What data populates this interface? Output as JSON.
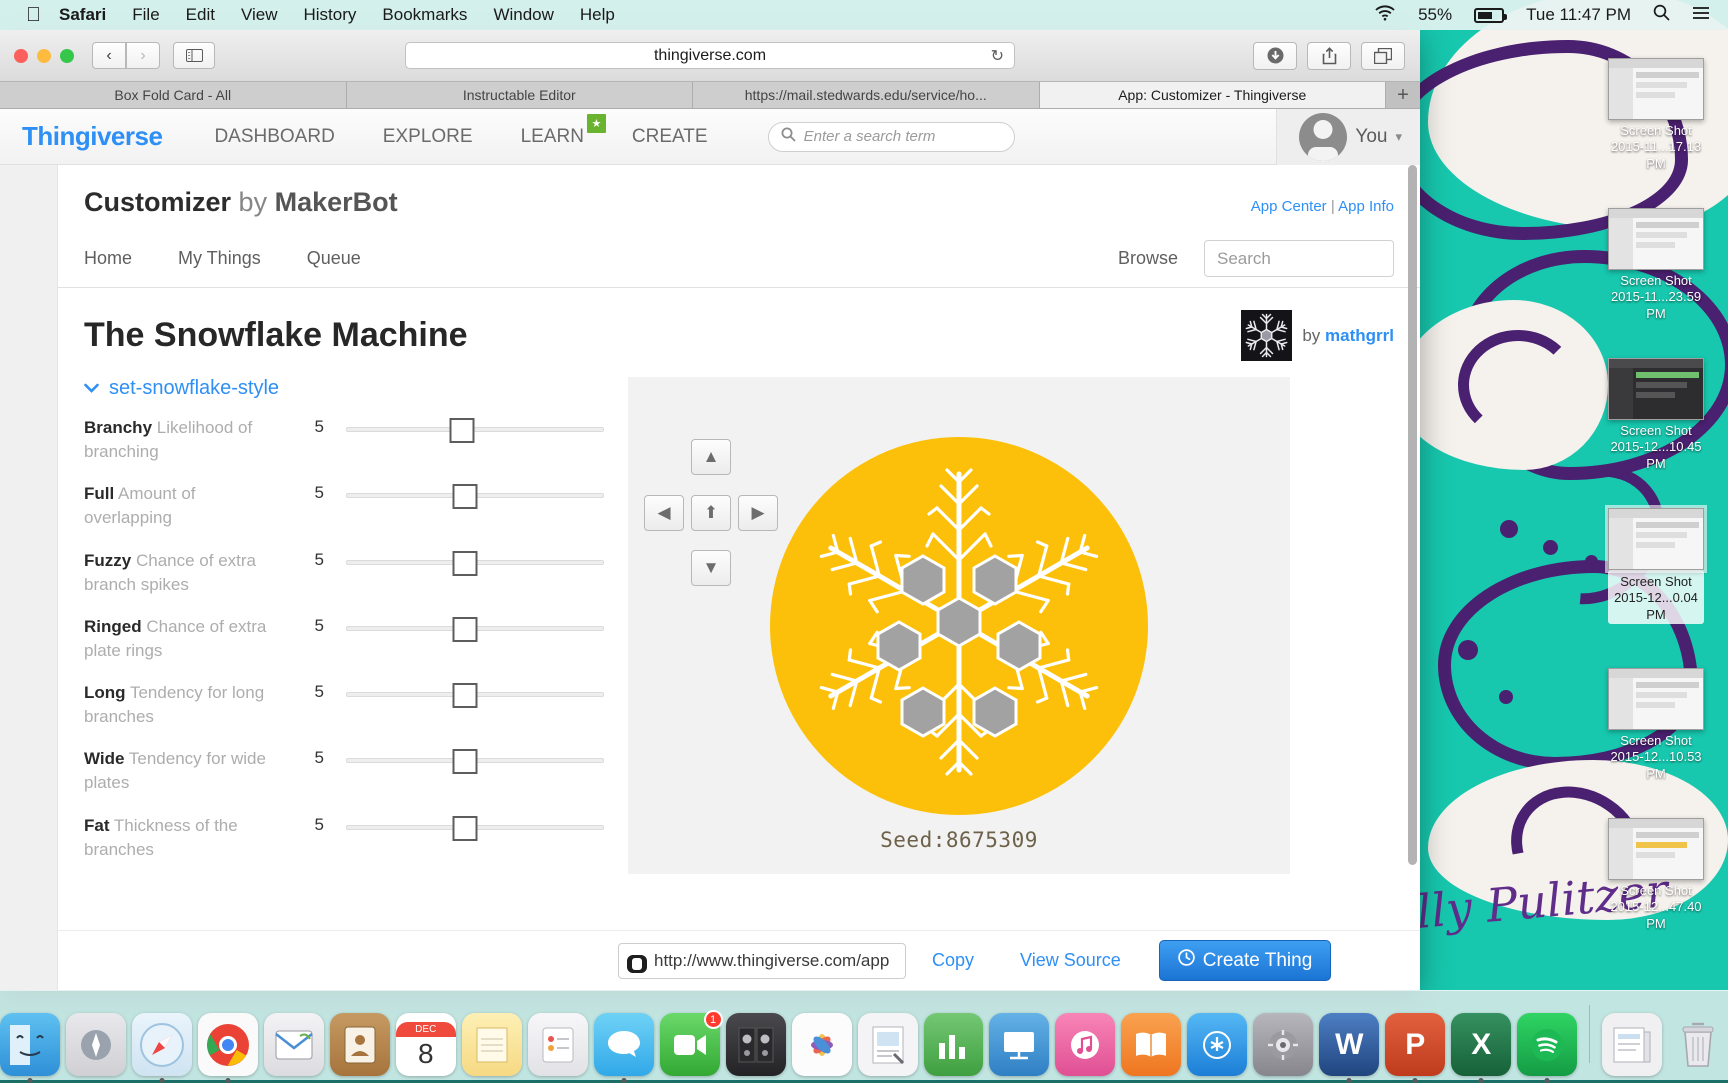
{
  "menubar": {
    "apple_icon": "apple-logo",
    "items": [
      {
        "label": "Safari",
        "bold": true
      },
      {
        "label": "File",
        "bold": false
      },
      {
        "label": "Edit",
        "bold": false
      },
      {
        "label": "View",
        "bold": false
      },
      {
        "label": "History",
        "bold": false
      },
      {
        "label": "Bookmarks",
        "bold": false
      },
      {
        "label": "Window",
        "bold": false
      },
      {
        "label": "Help",
        "bold": false
      }
    ],
    "wifi_icon": "wifi-icon",
    "battery_percent": "55%",
    "battery_icon": "battery-icon",
    "clock": "Tue 11:47 PM",
    "spotlight_icon": "search-icon",
    "notification_icon": "notification-center-icon"
  },
  "safari": {
    "back_label": "‹",
    "forward_label": "›",
    "sidebar_icon": "sidebar-icon",
    "url": "thingiverse.com",
    "reload_label": "↻",
    "download_icon": "download-icon",
    "share_icon": "share-icon",
    "tabs_icon": "show-all-tabs-icon",
    "new_tab_label": "+",
    "tabs": [
      {
        "label": "Box Fold Card - All",
        "active": false
      },
      {
        "label": "Instructable Editor",
        "active": false
      },
      {
        "label": "https://mail.stedwards.edu/service/ho...",
        "active": false
      },
      {
        "label": "App: Customizer - Thingiverse",
        "active": true
      }
    ]
  },
  "thingiverse_nav": {
    "logo": "Thingiverse",
    "links": [
      "DASHBOARD",
      "EXPLORE",
      "LEARN",
      "CREATE"
    ],
    "learn_badge": "★",
    "search_placeholder": "Enter a search term",
    "search_value": "",
    "search_icon": "search-icon",
    "account_label": "You",
    "account_caret": "▾",
    "avatar_icon": "avatar-icon"
  },
  "app": {
    "title_main": "Customizer",
    "title_by": "by",
    "title_author": "MakerBot",
    "links": {
      "app_center": "App Center",
      "separator": "|",
      "app_info": "App Info"
    },
    "tabs": [
      "Home",
      "My Things",
      "Queue"
    ],
    "browse_label": "Browse",
    "search_placeholder": "Search",
    "search_value": ""
  },
  "thing": {
    "title": "The Snowflake Machine",
    "by_label": "by",
    "author": "mathgrrl",
    "thumbnail_icon": "snowflake-thumbnail"
  },
  "customizer": {
    "group_name": "set-snowflake-style",
    "group_chevron": "❯",
    "parameters": [
      {
        "name": "Branchy",
        "description": "Likelihood of branching",
        "value": "5",
        "percent": 45
      },
      {
        "name": "Full",
        "description": "Amount of overlapping",
        "value": "5",
        "percent": 46
      },
      {
        "name": "Fuzzy",
        "description": "Chance of extra branch spikes",
        "value": "5",
        "percent": 46
      },
      {
        "name": "Ringed",
        "description": "Chance of extra plate rings",
        "value": "5",
        "percent": 46
      },
      {
        "name": "Long",
        "description": "Tendency for long branches",
        "value": "5",
        "percent": 46
      },
      {
        "name": "Wide",
        "description": "Tendency for wide plates",
        "value": "5",
        "percent": 46
      },
      {
        "name": "Fat",
        "description": "Thickness of the branches",
        "value": "5",
        "percent": 46
      }
    ]
  },
  "preview": {
    "nav_up_small": "▲",
    "nav_left": "◀",
    "nav_home": "⬆",
    "nav_right": "▶",
    "nav_down": "▼",
    "seed_label": "Seed:8675309",
    "render_color": "#fcc00a",
    "render_icon": "snowflake-render"
  },
  "bottom_bar": {
    "share_url": "http://www.thingiverse.com/app",
    "link_icon": "link-icon",
    "copy_label": "Copy",
    "view_source_label": "View Source",
    "create_label": "Create Thing",
    "create_icon": "plus-circle-icon",
    "create_color": "#1b74d4"
  },
  "desktop": {
    "wallpaper_colors": {
      "teal": "#17c8ae",
      "purple": "#4a2070",
      "cream": "#f5f1ec"
    },
    "brand_script": "Lilly Pulitzer",
    "screenshots": [
      {
        "caption_line1": "Screen Shot",
        "caption_line2": "2015-11...17.13 PM",
        "selected": false
      },
      {
        "caption_line1": "Screen Shot",
        "caption_line2": "2015-11...23.59 PM",
        "selected": false
      },
      {
        "caption_line1": "Screen Shot",
        "caption_line2": "2015-12...10.45 PM",
        "selected": false
      },
      {
        "caption_line1": "Screen Shot",
        "caption_line2": "2015-12...0.04 PM",
        "selected": true
      },
      {
        "caption_line1": "Screen Shot",
        "caption_line2": "2015-12...10.53 PM",
        "selected": false
      },
      {
        "caption_line1": "Screen Shot",
        "caption_line2": "2015-12...47.40 PM",
        "selected": false
      }
    ]
  },
  "dock": {
    "items": [
      {
        "name": "finder",
        "glyph": "☺",
        "color": "#3aa3e8",
        "running": true,
        "badge": ""
      },
      {
        "name": "launchpad",
        "glyph": "◴",
        "color": "#d8d8da",
        "running": false,
        "badge": ""
      },
      {
        "name": "safari",
        "glyph": "◎",
        "color": "#e9e9ea",
        "running": true,
        "badge": ""
      },
      {
        "name": "chrome",
        "glyph": "◉",
        "color": "#f4f4f5",
        "running": true,
        "badge": ""
      },
      {
        "name": "mail",
        "glyph": "✉",
        "color": "#e7e7e8",
        "running": false,
        "badge": ""
      },
      {
        "name": "contacts",
        "glyph": "☰",
        "color": "#b98a4f",
        "running": false,
        "badge": ""
      },
      {
        "name": "calendar",
        "glyph": "8",
        "color": "#ffffff",
        "running": false,
        "badge": "",
        "sublabel": "DEC"
      },
      {
        "name": "notes",
        "glyph": "≡",
        "color": "#fde68a",
        "running": false,
        "badge": ""
      },
      {
        "name": "reminders",
        "glyph": "✓",
        "color": "#eeeeef",
        "running": false,
        "badge": ""
      },
      {
        "name": "messages",
        "glyph": "●",
        "color": "#4cc2f1",
        "running": true,
        "badge": ""
      },
      {
        "name": "facetime",
        "glyph": "▶",
        "color": "#49ba49",
        "running": false,
        "badge": "1"
      },
      {
        "name": "itunes-speakers",
        "glyph": "▣",
        "color": "#2e2e30",
        "running": false,
        "badge": ""
      },
      {
        "name": "photos",
        "glyph": "❀",
        "color": "#f7f7f8",
        "running": false,
        "badge": ""
      },
      {
        "name": "keynote-deck",
        "glyph": "▤",
        "color": "#f0f0f1",
        "running": false,
        "badge": ""
      },
      {
        "name": "numbers",
        "glyph": "▐",
        "color": "#4fb34f",
        "running": false,
        "badge": ""
      },
      {
        "name": "keynote",
        "glyph": "▭",
        "color": "#3f9bd8",
        "running": false,
        "badge": ""
      },
      {
        "name": "itunes",
        "glyph": "♫",
        "color": "#f06ea9",
        "running": false,
        "badge": ""
      },
      {
        "name": "ibooks",
        "glyph": "□",
        "color": "#f58a33",
        "running": false,
        "badge": ""
      },
      {
        "name": "app-store",
        "glyph": "A",
        "color": "#2e9bf0",
        "running": false,
        "badge": ""
      },
      {
        "name": "system-preferences",
        "glyph": "⚙",
        "color": "#8e8e93",
        "running": false,
        "badge": ""
      },
      {
        "name": "word",
        "glyph": "W",
        "color": "#2b579a",
        "running": true,
        "badge": ""
      },
      {
        "name": "powerpoint",
        "glyph": "P",
        "color": "#d24726",
        "running": true,
        "badge": ""
      },
      {
        "name": "excel",
        "glyph": "X",
        "color": "#217346",
        "running": true,
        "badge": ""
      },
      {
        "name": "spotify",
        "glyph": "♪",
        "color": "#1db954",
        "running": true,
        "badge": ""
      }
    ],
    "stack_icon": "documents-stack",
    "trash_icon": "trash-icon"
  }
}
